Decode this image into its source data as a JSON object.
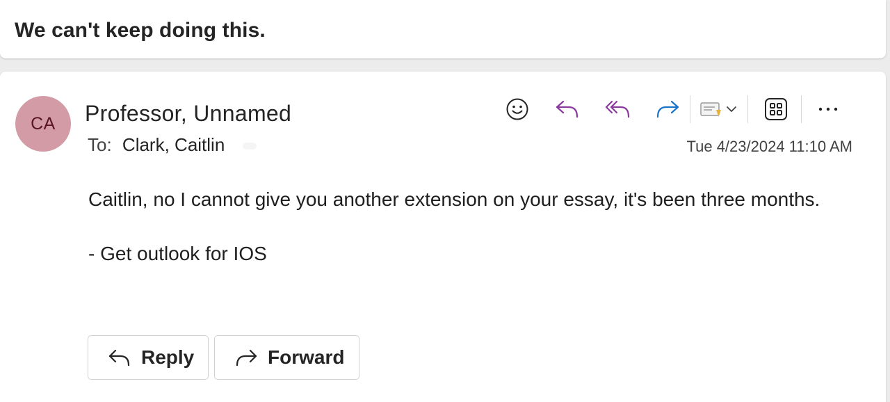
{
  "subject": "We can't keep doing this.",
  "message": {
    "avatar_initials": "CA",
    "avatar_color": "#d29ba6",
    "sender": "Professor, Unnamed",
    "to_label": "To:",
    "to_name": "Clark, Caitlin",
    "date": "Tue 4/23/2024 11:10 AM",
    "body_line1": "Caitlin, no I cannot give you another extension on your essay, it's been three months.",
    "signature": "- Get outlook for IOS"
  },
  "toolbar": {
    "icons": [
      "emoji-icon",
      "reply-icon",
      "reply-all-icon",
      "forward-icon",
      "message-flag-icon",
      "chevron-down-icon",
      "apps-icon",
      "more-icon"
    ],
    "accent_purple": "#8a3a9c",
    "accent_blue": "#1a73c9"
  },
  "actions": {
    "reply_label": "Reply",
    "forward_label": "Forward"
  }
}
